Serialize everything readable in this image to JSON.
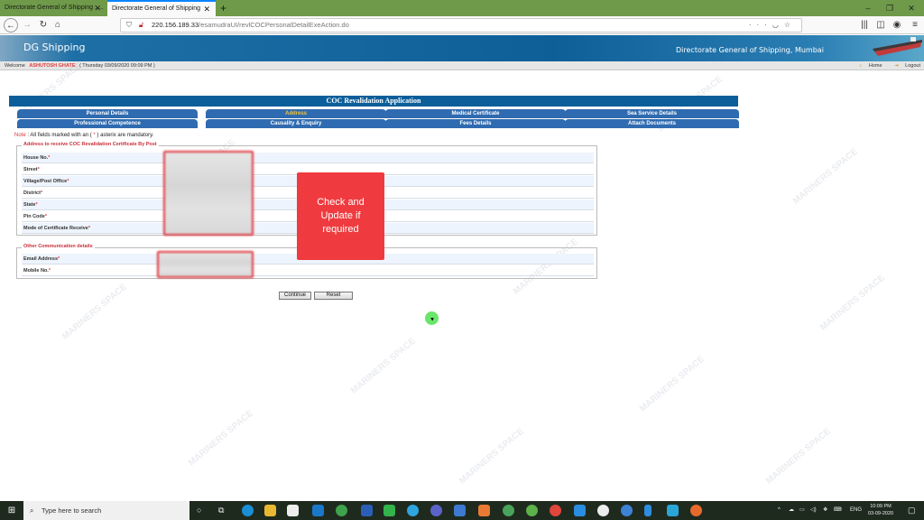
{
  "browser": {
    "tabs": [
      {
        "label": "Directorate General of Shipping : ..."
      },
      {
        "label": "Directorate General of Shipping"
      }
    ],
    "url_host": "220.156.189.33",
    "url_path": "/esamudraUI/revlCOCPersonalDetailExeAction.do",
    "icons": [
      "back-icon",
      "forward-icon",
      "reload-icon",
      "home-icon",
      "shield-icon",
      "insecure-lock-icon",
      "more-icon",
      "pocket-icon",
      "bookmark-star-icon",
      "library-icon",
      "sidebar-icon",
      "account-icon",
      "menu-icon"
    ]
  },
  "header": {
    "site_title": "DG Shipping",
    "site_subtitle": "Directorate General of Shipping, Mumbai",
    "welcome_label": "Welcome",
    "user_name": "ASHUTOSH GHATE",
    "datetime": "( Thursday 03/09/2020 09:09 PM )",
    "home_label": "Home",
    "logout_label": "Logout"
  },
  "form": {
    "title": "COC Revalidation Application",
    "tabs": [
      {
        "label": "Personal Details",
        "active": false
      },
      {
        "label": "Address",
        "active": true
      },
      {
        "label": "Medical Certificate",
        "active": false
      },
      {
        "label": "Sea Service Details",
        "active": false
      },
      {
        "label": "Professional Competence",
        "active": false
      },
      {
        "label": "Causality & Enquiry",
        "active": false
      },
      {
        "label": "Fees Details",
        "active": false
      },
      {
        "label": "Attach Documents",
        "active": false
      }
    ],
    "note_label": "Note",
    "note_text": " : All fields marked with an ( ",
    "note_ast": "*",
    "note_tail": " ) asterix are mandatory.",
    "address_group": {
      "legend": "Address to receive COC Revalidation Certificate By Post",
      "fields": [
        {
          "label": "House No.",
          "value": ""
        },
        {
          "label": "Street",
          "value": ""
        },
        {
          "label": "Village/Post Office",
          "value": ""
        },
        {
          "label": "District",
          "value": ""
        },
        {
          "label": "State",
          "value": ""
        },
        {
          "label": "Pin Code",
          "value": ""
        },
        {
          "label": "Mode of Certificate Receive",
          "value": ""
        }
      ]
    },
    "comm_group": {
      "legend": "Other Communication details",
      "fields": [
        {
          "label": "Email Address",
          "value": ""
        },
        {
          "label": "Mobile No.",
          "value": ""
        }
      ]
    },
    "required_mark": "*",
    "continue_label": "Continue",
    "reset_label": "Reset"
  },
  "callout": {
    "line1": "Check and",
    "line2": "Update if",
    "line3": "required",
    "color": "#ef3b3f"
  },
  "watermark": "MARINERS SPACE",
  "taskbar": {
    "search_placeholder": "Type here to search",
    "language": "ENG",
    "time": "10:09 PM",
    "date": "03-09-2020"
  }
}
